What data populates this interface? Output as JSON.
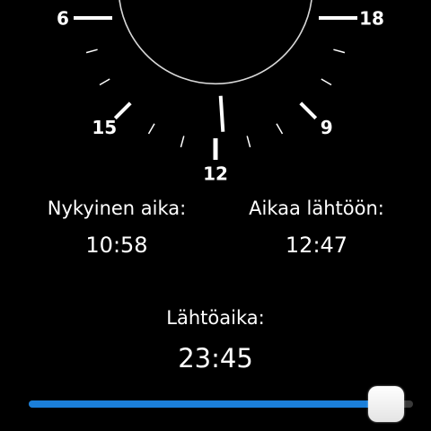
{
  "dial": {
    "hour_labels": [
      "6",
      "9",
      "12",
      "15",
      "18"
    ],
    "indicated_hour": 11.75,
    "colors": {
      "ring": "#d8d8d8",
      "ticks": "#ffffff",
      "hand": "#ffffff"
    }
  },
  "info": {
    "current_label": "Nykyinen aika:",
    "current_value": "10:58",
    "remaining_label": "Aikaa lähtöön:",
    "remaining_value": "12:47",
    "departure_label": "Lähtöaika:",
    "departure_value": "23:45"
  },
  "slider": {
    "value_fraction": 0.95,
    "colors": {
      "fill": "#1b7fd9",
      "thumb": "#ffffff"
    }
  }
}
